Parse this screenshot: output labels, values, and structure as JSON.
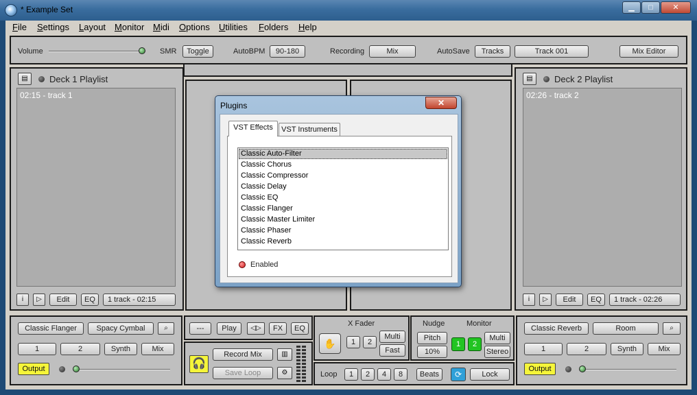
{
  "window": {
    "title": "* Example Set",
    "min": "▁",
    "max": "□",
    "close": "✕"
  },
  "menu": [
    "File",
    "Settings",
    "Layout",
    "Monitor",
    "Midi",
    "Options",
    "Utilities",
    "Folders",
    "Help"
  ],
  "menu_underline": [
    "F",
    "S",
    "L",
    "M",
    "M",
    "O",
    "U",
    "F",
    "H"
  ],
  "menu_rest": [
    "ile",
    "ettings",
    "ayout",
    "onitor",
    "idi",
    "ptions",
    "tilities",
    "olders",
    "elp"
  ],
  "top": {
    "volume_label": "Volume",
    "volume_level": 0.97,
    "smr_label": "SMR",
    "toggle": "Toggle",
    "autobpm_label": "AutoBPM",
    "autobpm_value": "90-180",
    "recording_label": "Recording",
    "recording_value": "Mix",
    "autosave_label": "AutoSave",
    "autosave_value": "Tracks",
    "track_value": "Track 001",
    "mix_editor": "Mix Editor"
  },
  "deck1": {
    "title": "Deck 1 Playlist",
    "item": "02:15 - track 1",
    "edit": "Edit",
    "eq": "EQ",
    "summary": "1 track - 02:15"
  },
  "deck2": {
    "title": "Deck 2 Playlist",
    "item": "02:26 - track 2",
    "edit": "Edit",
    "eq": "EQ",
    "summary": "1 track - 02:26"
  },
  "fx1": {
    "effect1": "Classic Flanger",
    "effect2": "Spacy Cymbal",
    "b1": "1",
    "b2": "2",
    "synth": "Synth",
    "mix": "Mix",
    "output": "Output"
  },
  "fx2": {
    "effect1": "Classic Reverb",
    "effect2": "Room",
    "b1": "1",
    "b2": "2",
    "synth": "Synth",
    "mix": "Mix",
    "output": "Output"
  },
  "center": {
    "dash": "---",
    "play": "Play",
    "fx": "FX",
    "eq": "EQ",
    "record_mix": "Record Mix",
    "save_loop": "Save Loop",
    "xfader_label": "X Fader",
    "x1": "1",
    "x2": "2",
    "multi": "Multi",
    "fast": "Fast",
    "nudge_label": "Nudge",
    "monitor_label": "Monitor",
    "pitch": "Pitch",
    "pct": "10%",
    "m1": "1",
    "m2": "2",
    "multi2": "Multi",
    "stereo": "Stereo",
    "loop_label": "Loop",
    "l1": "1",
    "l2": "2",
    "l4": "4",
    "l8": "8",
    "beats": "Beats",
    "lock": "Lock"
  },
  "dialog": {
    "title": "Plugins",
    "close": "✕",
    "tab1": "VST Effects",
    "tab2": "VST Instruments",
    "plugins": [
      "Classic Auto-Filter",
      "Classic Chorus",
      "Classic Compressor",
      "Classic Delay",
      "Classic EQ",
      "Classic Flanger",
      "Classic Master Limiter",
      "Classic Phaser",
      "Classic Reverb"
    ],
    "enabled": "Enabled"
  },
  "colors": {
    "output": "#f5f53a",
    "monitor_on": "#22c422",
    "enabled_led": "#e03030",
    "titlebar": "#3a6d9e"
  }
}
